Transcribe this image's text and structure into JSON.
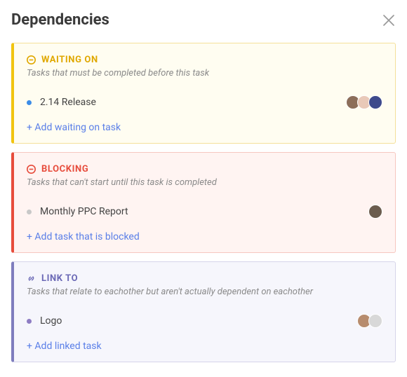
{
  "title": "Dependencies",
  "sections": {
    "waiting": {
      "label": "WAITING ON",
      "description": "Tasks that must be completed before this task",
      "task": "2.14 Release",
      "add_label": "+ Add waiting on task",
      "bullet_color": "#3C8CE7",
      "avatars": [
        "#8C6E5A",
        "#E9C9B8",
        "#3E4A8C"
      ]
    },
    "blocking": {
      "label": "BLOCKING",
      "description": "Tasks that can't start until this task is completed",
      "task": "Monthly PPC Report",
      "add_label": "+ Add task that is blocked",
      "bullet_color": "#C8C8C8",
      "avatars": [
        "#6B5C4E"
      ]
    },
    "linkto": {
      "label": "LINK TO",
      "description": "Tasks that relate to eachother but aren't actually dependent on eachother",
      "task": "Logo",
      "add_label": "+ Add linked task",
      "bullet_color": "#8E7CC3",
      "avatars": [
        "#B78C6E",
        "#D8D8D8"
      ]
    }
  }
}
